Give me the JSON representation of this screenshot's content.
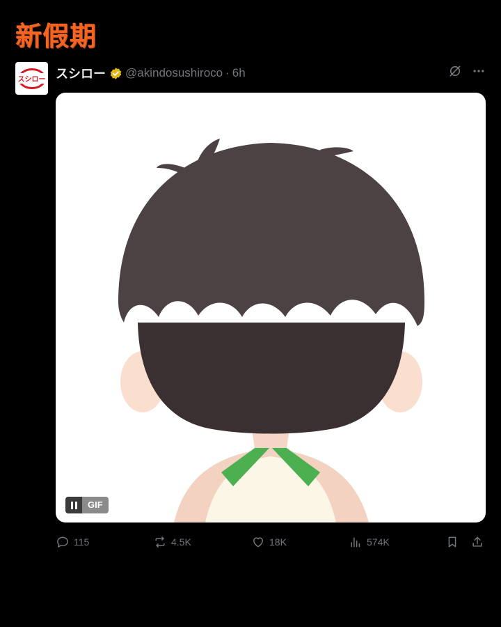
{
  "overlay": {
    "brand_text": "新假期",
    "brand_color": "#f26522"
  },
  "tweet": {
    "avatar_text": "スシロー",
    "avatar_color": "#d71920",
    "display_name": "スシロー",
    "verified_icon": "verified-badge-icon",
    "handle": "@akindosushiroco",
    "separator": "·",
    "time": "6h",
    "header_icons": [
      "grok-icon",
      "more-icon"
    ],
    "media": {
      "type": "gif",
      "badge_label": "GIF",
      "control_icon": "pause-icon"
    },
    "actions": {
      "replies": "115",
      "reposts": "4.5K",
      "likes": "18K",
      "views": "574K",
      "icons": [
        "reply-icon",
        "repost-icon",
        "like-icon",
        "views-icon",
        "bookmark-icon",
        "share-icon"
      ]
    },
    "colors": {
      "text_primary": "#e7e9ea",
      "text_secondary": "#71767b",
      "background": "#000000",
      "verified": "#e2b719"
    }
  }
}
